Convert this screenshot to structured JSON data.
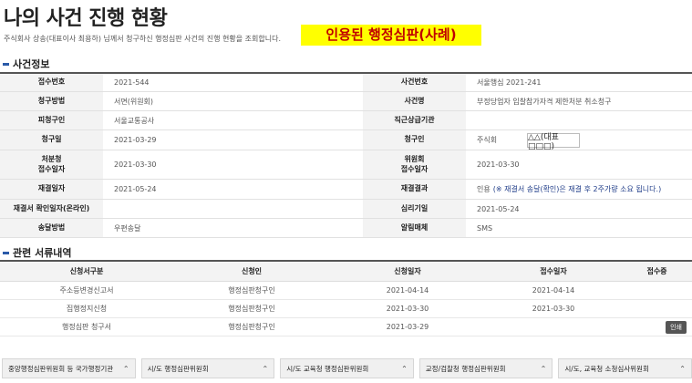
{
  "header": {
    "title": "나의 사건 진행 현황",
    "description": "주식회사 상송(대표이사 최용하) 님께서 청구하신 행정심판 사건의 진행 현황을 조회합니다.",
    "highlight": "인용된 행정심판(사례)",
    "highlight_color": "#ffff00",
    "highlight_text_color": "#c00000"
  },
  "case_info": {
    "section_title": "사건정보",
    "rows": [
      {
        "l1": "접수번호",
        "v1": "2021-544",
        "l2": "사건번호",
        "v2": "서울행심 2021-241"
      },
      {
        "l1": "청구방법",
        "v1": "서면(위원회)",
        "l2": "사건명",
        "v2": "부정당업자 입찰참가자격 제한처분 취소청구"
      },
      {
        "l1": "피청구인",
        "v1": "서울교통공사",
        "l2": "직근상급기관",
        "v2": ""
      },
      {
        "l1": "청구일",
        "v1": "2021-03-29",
        "l2": "청구인",
        "v2": "주식회"
      },
      {
        "l1": "처분청\n접수일자",
        "v1": "2021-03-30",
        "l2": "위원회\n접수일자",
        "v2": "2021-03-30"
      },
      {
        "l1": "재결일자",
        "v1": "2021-05-24",
        "l2": "재결결과",
        "v2": "인용",
        "v2_note": "(※ 재결서 송달(확인)은 재결 후 2주가량 소요 됩니다.)"
      },
      {
        "l1": "재결서 확인일자(온라인)",
        "v1": "",
        "l2": "심리기일",
        "v2": "2021-05-24"
      },
      {
        "l1": "송달방법",
        "v1": "우편송달",
        "l2": "알림매체",
        "v2": "SMS"
      }
    ],
    "claimant_overlay": "△△(대표□□□)"
  },
  "documents": {
    "section_title": "관련 서류내역",
    "columns": [
      "신청서구분",
      "신청인",
      "신청일자",
      "접수일자",
      "접수증"
    ],
    "rows": [
      {
        "type": "주소등변경신고서",
        "applicant": "행정심판청구인",
        "applied": "2021-04-14",
        "received": "2021-04-14",
        "receipt": ""
      },
      {
        "type": "집행정지신청",
        "applicant": "행정심판청구인",
        "applied": "2021-03-30",
        "received": "2021-03-30",
        "receipt": ""
      },
      {
        "type": "행정심판 청구서",
        "applicant": "행정심판청구인",
        "applied": "2021-03-29",
        "received": "",
        "receipt": "인쇄"
      }
    ]
  },
  "bottom_links": [
    "중앙행정심판위원회 등 국가행정기관",
    "시/도 행정심판위원회",
    "시/도 교육청 행정심판위원회",
    "교정/검찰청 행정심판위원회",
    "시/도, 교육청 소청심사위원회"
  ],
  "icons": {
    "chevron": "chevron-up-icon",
    "section_marker": "section-bar-icon"
  },
  "accent_color": "#2a5aa8"
}
